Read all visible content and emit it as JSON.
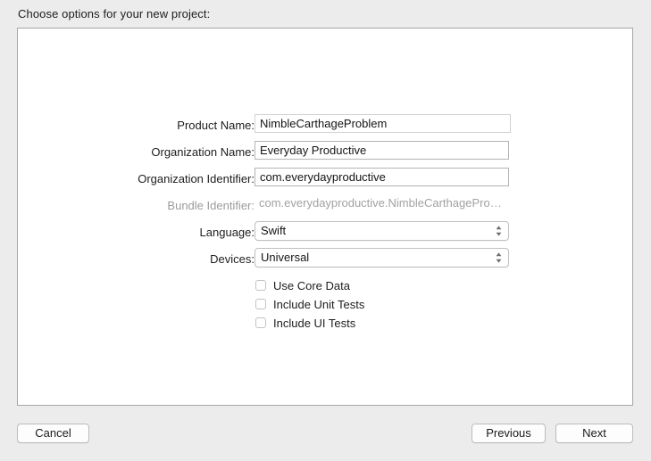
{
  "dialog": {
    "prompt": "Choose options for your new project:"
  },
  "form": {
    "fields": [
      {
        "label": "Product Name:",
        "value": "NimbleCarthageProblem",
        "type": "text",
        "name": "product-name",
        "readonly": false
      },
      {
        "label": "Organization Name:",
        "value": "Everyday Productive",
        "type": "text",
        "name": "organization-name",
        "readonly": false
      },
      {
        "label": "Organization Identifier:",
        "value": "com.everydayproductive",
        "type": "text",
        "name": "organization-identifier",
        "readonly": false
      },
      {
        "label": "Bundle Identifier:",
        "value": "com.everydayproductive.NimbleCarthageProble…",
        "type": "readonly",
        "name": "bundle-identifier",
        "readonly": true
      },
      {
        "label": "Language:",
        "value": "Swift",
        "type": "popup",
        "name": "language",
        "readonly": false
      },
      {
        "label": "Devices:",
        "value": "Universal",
        "type": "popup",
        "name": "devices",
        "readonly": false
      }
    ],
    "checkboxes": [
      {
        "label": "Use Core Data",
        "checked": false,
        "name": "use-core-data"
      },
      {
        "label": "Include Unit Tests",
        "checked": false,
        "name": "include-unit-tests"
      },
      {
        "label": "Include UI Tests",
        "checked": false,
        "name": "include-ui-tests"
      }
    ]
  },
  "footer": {
    "cancel": "Cancel",
    "previous": "Previous",
    "next": "Next"
  }
}
